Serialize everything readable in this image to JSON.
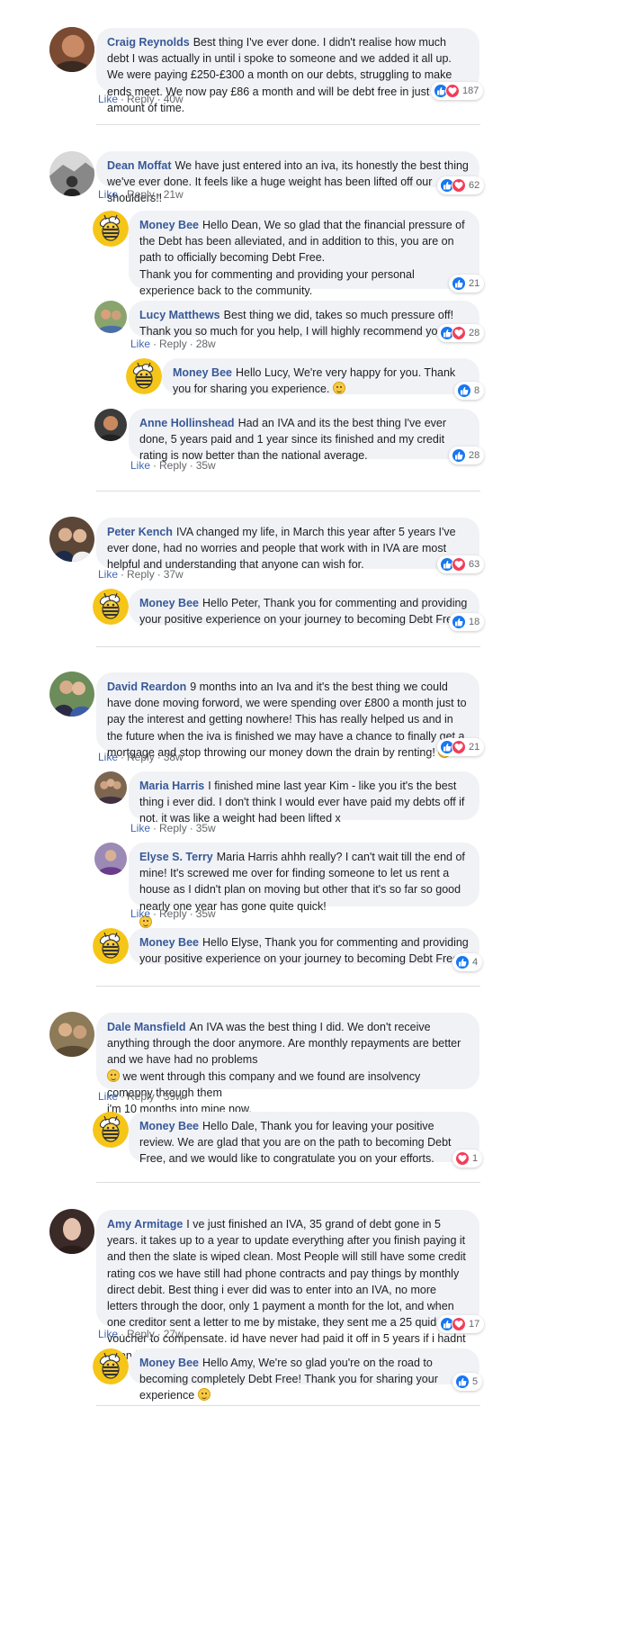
{
  "actions": {
    "like": "Like",
    "reply": "Reply"
  },
  "threads": [
    {
      "top": {
        "name": "Craig Reynolds",
        "text": "Best thing I've ever done. I didn't realise how much debt I was actually in until i spoke to someone and we added it all up. We were paying £250-£300 a month on our debts, struggling to make ends meet. We now pay £86 a month and will be debt free in just short amount of time.",
        "time": "40w",
        "reactions": "187"
      }
    },
    {
      "top": {
        "name": "Dean Moffat",
        "text": "We have just entered into an iva, its honestly the best thing we've ever done. It feels like a huge weight has been lifted off our shoulders!!",
        "time": "21w",
        "reactions": "62"
      },
      "replies": [
        {
          "name": "Money Bee",
          "text": "Hello Dean, We so glad that the financial pressure of the Debt has been alleviated, and in addition to this, you are on path to officially becoming Debt Free.",
          "text2": "Thank you for commenting and providing your personal experience back to the community.",
          "reactions": "21"
        },
        {
          "name": "Lucy Matthews",
          "text": "Best thing we did, takes so much pressure off! Thank you so much for you help, I will highly recommend you",
          "time": "28w",
          "reactions": "28"
        },
        {
          "name": "Money Bee",
          "text": "Hello Lucy, We're very happy for you. Thank you for sharing you experience.",
          "reactions": "8"
        },
        {
          "name": "Anne Hollinshead",
          "text": "Had an IVA and its the best thing I've ever done, 5 years paid and 1 year since its finished and my credit rating is now better than the national average.",
          "time": "35w",
          "reactions": "28"
        }
      ]
    },
    {
      "top": {
        "name": "Peter Kench",
        "text": "IVA changed my life, in March this year after 5 years I've ever done, had no worries and people that work with in IVA are most helpful and understanding that anyone can wish for.",
        "time": "37w",
        "reactions": "63"
      },
      "replies": [
        {
          "name": "Money Bee",
          "text": "Hello Peter, Thank you for commenting and providing your positive experience on your journey to becoming Debt Free.",
          "reactions": "18"
        }
      ]
    },
    {
      "top": {
        "name": "David Reardon",
        "text": "9 months into an Iva and it's the best thing we could have done moving forword, we were spending over £800 a month just to pay the interest and getting nowhere! This has really helped us and in the future when the iva is finished we may have a chance to finally get a mortgage and stop throwing our money down the drain by renting!",
        "time": "38w",
        "reactions": "21"
      },
      "replies": [
        {
          "name": "Maria Harris",
          "text": "I finished mine last year Kim - like you it's the best thing i ever did. I don't think I would ever have paid my debts off if not. it was like a weight had been lifted x",
          "time": "35w"
        },
        {
          "name": "Elyse S. Terry",
          "text": "Maria Harris ahhh really? I can't wait till the end of mine! It's screwed me over for finding someone to let us rent a house as I didn't plan on moving but other that it's so far so good nearly one year has gone quite quick!",
          "time": "35w"
        },
        {
          "name": "Money Bee",
          "text": "Hello Elyse, Thank you for commenting and providing your positive experience on your journey to becoming Debt Free.",
          "reactions": "4"
        }
      ]
    },
    {
      "top": {
        "name": "Dale Mansfield",
        "text": "An IVA was the best thing I did. We don't receive anything through the door anymore. Are monthly repayments are better and we have had no problems",
        "text2": "we went through this company and we found are insolvency comapny through them",
        "text3": "i'm 10 months into mine now.",
        "time": "39w"
      },
      "replies": [
        {
          "name": "Money Bee",
          "text": "Hello Dale, Thank you for leaving your positive review. We are glad that you are on the path to becoming Debt Free, and we would like to congratulate you on your efforts.",
          "reactions": "1"
        }
      ]
    },
    {
      "top": {
        "name": "Amy Armitage",
        "text": "I ve just finished an IVA, 35 grand of debt gone in 5 years. it takes up to a year to update everything after you finish paying it and then the slate is wiped clean. Most People will still have some credit rating cos we have still had phone contracts and pay things by monthly direct debit. Best thing i ever did was to enter into an IVA, no more letters through the door, only 1 payment a month for the lot, and when one creditor sent a letter to me by mistake, they sent me a 25 quid gift voucher to compensate. id have never had paid it off in 5 years if i hadnt doen it this way. im now completely debt free and can start again xx",
        "time": "27w",
        "reactions": "17"
      },
      "replies": [
        {
          "name": "Money Bee",
          "text": "Hello Amy, We're so glad you're on the road to becoming completely Debt Free! Thank you for sharing your experience",
          "reactions": "5"
        }
      ]
    }
  ],
  "colors": {
    "name": "#385898",
    "link": "#4267b2",
    "meta": "#65676b",
    "bubble": "#f0f2f5",
    "like": "#1877f2",
    "love": "#f33e58",
    "bee": "#f5c518"
  },
  "icons": {
    "like": "thumbs-up-icon",
    "love": "heart-icon",
    "emoji": "smiley-emoji-icon",
    "bee": "bee-avatar-icon"
  }
}
